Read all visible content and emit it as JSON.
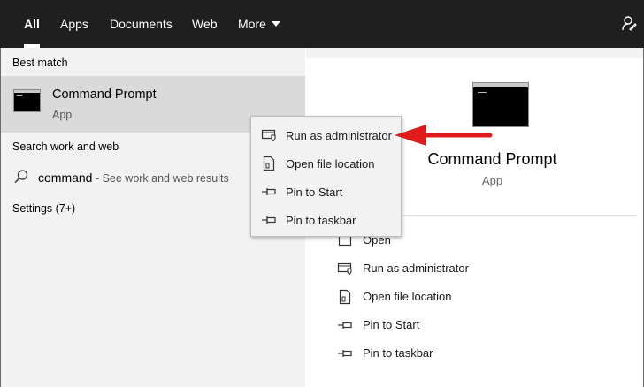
{
  "tabs": [
    {
      "label": "All"
    },
    {
      "label": "Apps"
    },
    {
      "label": "Documents"
    },
    {
      "label": "Web"
    },
    {
      "label": "More"
    }
  ],
  "left": {
    "best_match_label": "Best match",
    "best_match": {
      "title": "Command Prompt",
      "subtitle": "App"
    },
    "search_section_label": "Search work and web",
    "search_term": "command",
    "search_hint": " - See work and web results",
    "settings_label": "Settings (7+)"
  },
  "context_menu": {
    "items": [
      {
        "label": "Run as administrator",
        "icon": "shield-icon"
      },
      {
        "label": "Open file location",
        "icon": "file-location-icon"
      },
      {
        "label": "Pin to Start",
        "icon": "pin-icon"
      },
      {
        "label": "Pin to taskbar",
        "icon": "pin-icon"
      }
    ]
  },
  "right": {
    "title": "Command Prompt",
    "subtitle": "App",
    "actions": [
      {
        "label": "Open",
        "icon": "open-icon"
      },
      {
        "label": "Run as administrator",
        "icon": "shield-icon"
      },
      {
        "label": "Open file location",
        "icon": "file-location-icon"
      },
      {
        "label": "Pin to Start",
        "icon": "pin-icon"
      },
      {
        "label": "Pin to taskbar",
        "icon": "pin-icon"
      }
    ]
  },
  "colors": {
    "topbar": "#1f1f1f",
    "panel": "#f2f2f2",
    "selected": "#dadada",
    "arrow": "#e01b1b"
  }
}
